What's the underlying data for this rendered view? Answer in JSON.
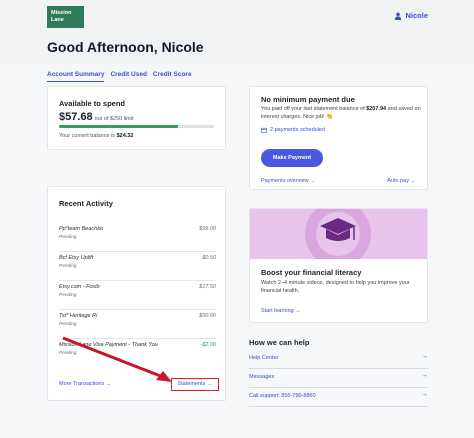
{
  "header": {
    "logo_text": "Mission Lane",
    "user_name": "Nicole",
    "greeting": "Good Afternoon, Nicole"
  },
  "tabs": [
    {
      "label": "Account Summary",
      "active": true
    },
    {
      "label": "Credit Used",
      "active": false
    },
    {
      "label": "Credit Score",
      "active": false
    }
  ],
  "spend": {
    "title": "Available to spend",
    "amount": "$57.68",
    "limit_text": "out of $250 limit",
    "balance_label": "Your current balance is",
    "balance_value": "$24.32",
    "progress_fraction": 0.77,
    "progress_color": "#3d9a5a"
  },
  "activity": {
    "title": "Recent Activity",
    "transactions": [
      {
        "name": "Pp*team Beachbo",
        "status": "Pending",
        "amount": "$99.00"
      },
      {
        "name": "Bcf Etsy Uplift",
        "status": "Pending",
        "amount": "$0.50"
      },
      {
        "name": "Etsy.com - Foxib",
        "status": "Pending",
        "amount": "$17.50"
      },
      {
        "name": "Tst* Heritage Ri",
        "status": "Pending",
        "amount": "$50.00"
      },
      {
        "name": "Mission Lane Visa Payment - Thank You",
        "status": "Pending",
        "amount": "-$2.00"
      }
    ],
    "more_link": "More Transactions",
    "statements_link": "Statements",
    "highlight_color": "#d61f2c"
  },
  "payment": {
    "title": "No minimum payment due",
    "desc_prefix": "You paid off your last statement balance of",
    "desc_amount": "$207.94",
    "desc_suffix": "and saved on interest charges. Nice job! 👏",
    "scheduled": "2 payments scheduled",
    "button": "Make Payment",
    "overview_link": "Payments overview",
    "autopay_link": "Auto pay"
  },
  "literacy": {
    "title": "Boost your financial literacy",
    "desc": "Watch 2–4 minute videos, designed to help you improve your financial health.",
    "link": "Start learning"
  },
  "help": {
    "title": "How we can help",
    "items": [
      {
        "label": "Help Center"
      },
      {
        "label": "Messages"
      },
      {
        "label": "Call support: 855-790-8860"
      }
    ]
  },
  "colors": {
    "accent": "#3b4fd0",
    "button": "#4a58e0",
    "brand_green": "#2f7a5a"
  }
}
